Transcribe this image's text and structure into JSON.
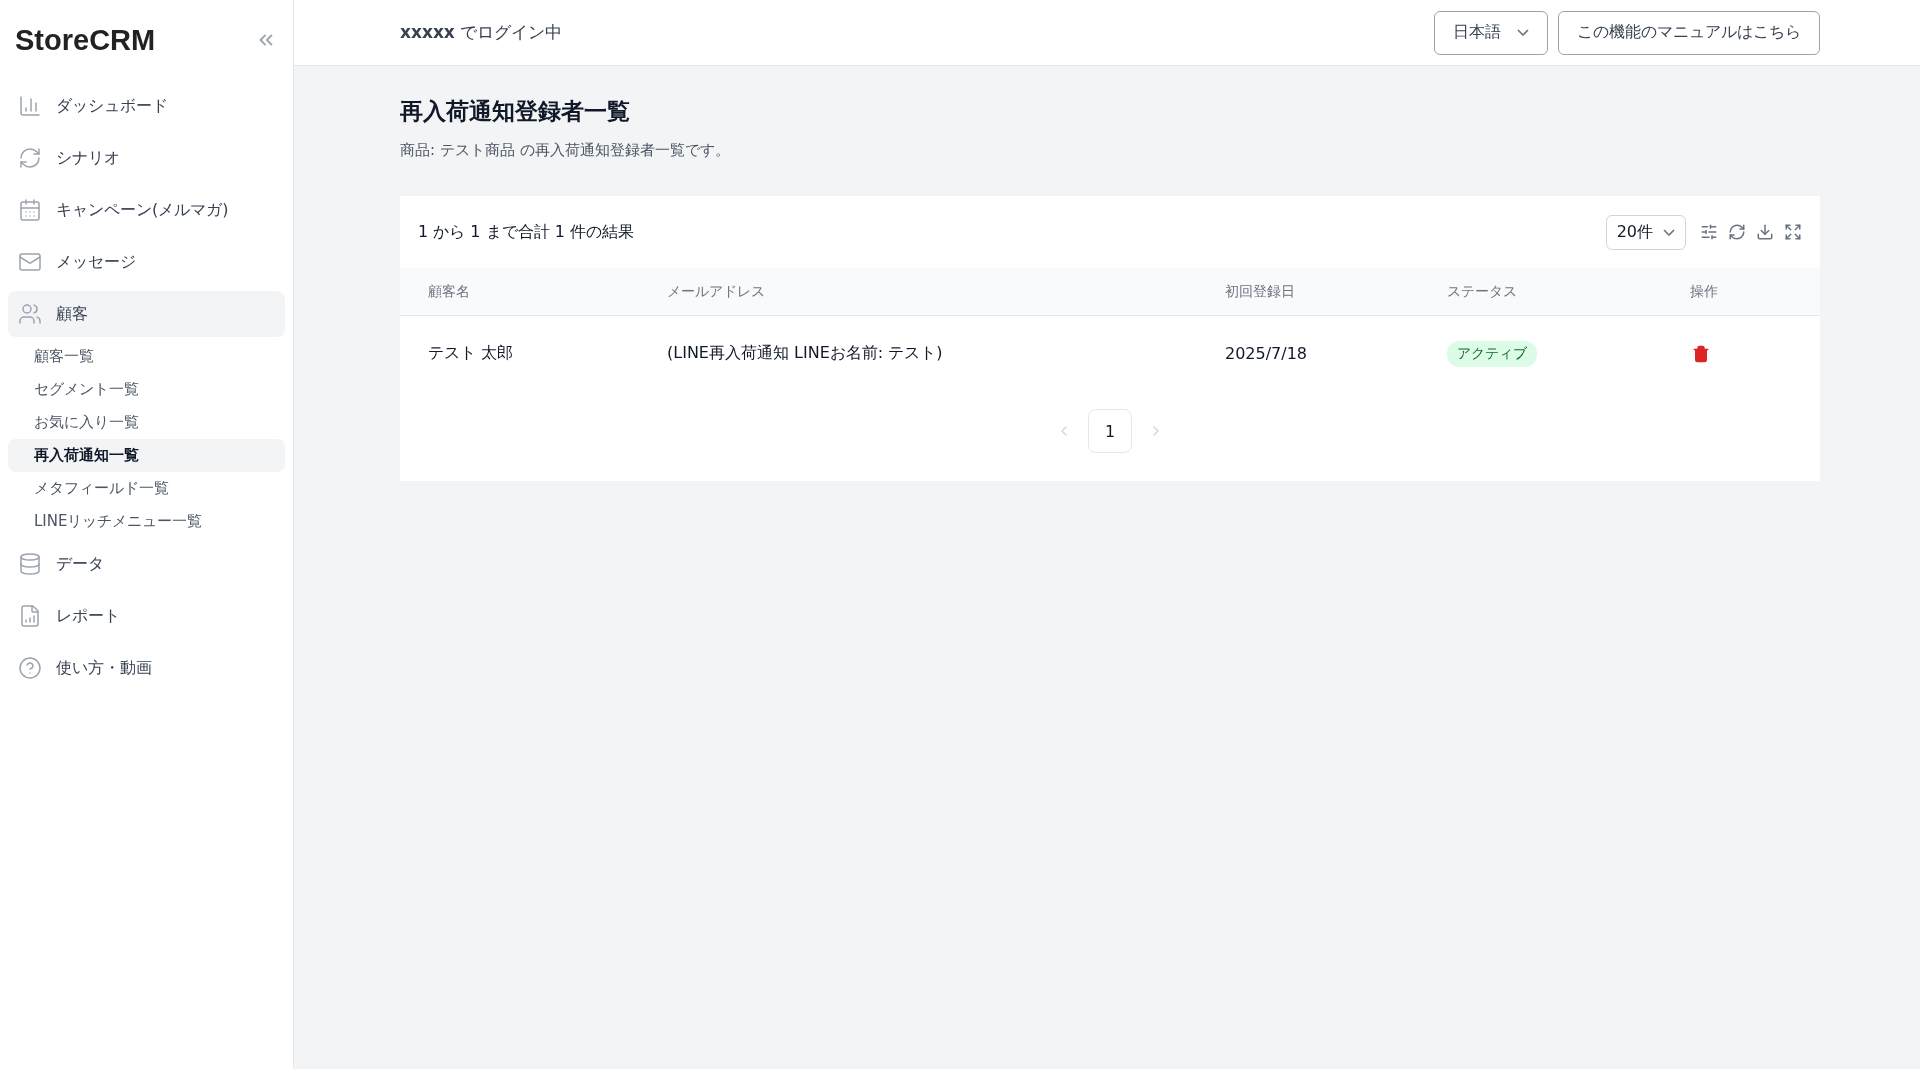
{
  "sidebar": {
    "logo": "StoreCRM",
    "items": [
      {
        "label": "ダッシュボード",
        "selected": false
      },
      {
        "label": "シナリオ",
        "selected": false
      },
      {
        "label": "キャンペーン(メルマガ)",
        "selected": false
      },
      {
        "label": "メッセージ",
        "selected": false
      },
      {
        "label": "顧客",
        "selected": true,
        "children": [
          {
            "label": "顧客一覧",
            "selected": false
          },
          {
            "label": "セグメント一覧",
            "selected": false
          },
          {
            "label": "お気に入り一覧",
            "selected": false
          },
          {
            "label": "再入荷通知一覧",
            "selected": true
          },
          {
            "label": "メタフィールド一覧",
            "selected": false
          },
          {
            "label": "LINEリッチメニュー一覧",
            "selected": false
          }
        ]
      },
      {
        "label": "データ",
        "selected": false
      },
      {
        "label": "レポート",
        "selected": false
      },
      {
        "label": "使い方・動画",
        "selected": false
      }
    ]
  },
  "header": {
    "user": "xxxxx",
    "login_text": "でログイン中",
    "language": "日本語",
    "manual_button": "この機能のマニュアルはこちら"
  },
  "page": {
    "title": "再入荷通知登録者一覧",
    "description": "商品: テスト商品 の再入荷通知登録者一覧です。"
  },
  "table": {
    "summary": "1 から 1 まで合計 1 件の結果",
    "page_size": "20件",
    "columns": [
      "顧客名",
      "メールアドレス",
      "初回登録日",
      "ステータス",
      "操作"
    ],
    "rows": [
      {
        "name": "テスト 太郎",
        "email": "(LINE再入荷通知 LINEお名前: テスト)",
        "registered": "2025/7/18",
        "status": {
          "label": "アクティブ",
          "color": "#dcfce7"
        }
      }
    ]
  },
  "pagination": {
    "prev_disabled": true,
    "next_disabled": true,
    "pages": [
      {
        "label": "1",
        "selected": true
      }
    ]
  }
}
